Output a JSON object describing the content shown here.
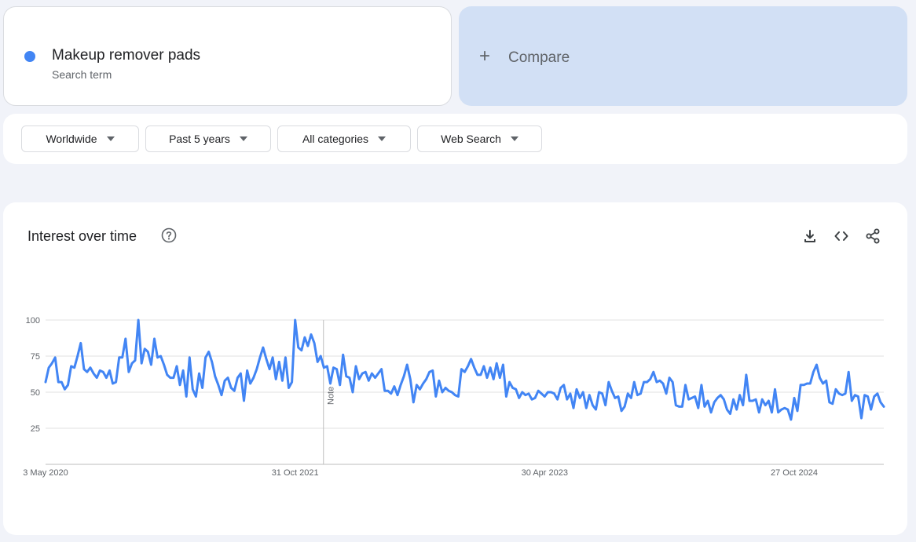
{
  "search_term": {
    "name": "Makeup remover pads",
    "subtitle": "Search term",
    "color": "#4285f4"
  },
  "compare": {
    "label": "Compare",
    "icon": "plus-icon"
  },
  "filters": [
    {
      "label": "Worldwide"
    },
    {
      "label": "Past 5 years"
    },
    {
      "label": "All categories"
    },
    {
      "label": "Web Search"
    }
  ],
  "chart_panel": {
    "title": "Interest over time",
    "icons": [
      "help-icon",
      "download-icon",
      "embed-icon",
      "share-icon"
    ]
  },
  "chart_data": {
    "type": "line",
    "title": "Interest over time",
    "y_ticks": [
      25,
      50,
      75,
      100
    ],
    "ylim": [
      0,
      100
    ],
    "x_ticks": [
      "3 May 2020",
      "31 Oct 2021",
      "30 Apr 2023",
      "27 Oct 2024"
    ],
    "start_date": "2020-05-03",
    "interval_days": 7,
    "note_label": "Note",
    "note_date": "2022-01-01",
    "line_color": "#4285f4",
    "grid": true,
    "series": [
      {
        "values": [
          57,
          67,
          70,
          74,
          57,
          57,
          52,
          55,
          68,
          67,
          75,
          84,
          66,
          64,
          67,
          63,
          60,
          65,
          64,
          60,
          65,
          56,
          57,
          74,
          74,
          87,
          64,
          70,
          72,
          100,
          70,
          80,
          78,
          69,
          87,
          74,
          75,
          69,
          62,
          60,
          60,
          68,
          55,
          65,
          47,
          74,
          52,
          47,
          63,
          53,
          74,
          78,
          71,
          61,
          55,
          48,
          58,
          60,
          53,
          51,
          60,
          63,
          44,
          65,
          56,
          60,
          66,
          74,
          81,
          73,
          66,
          74,
          59,
          71,
          58,
          74,
          53,
          57,
          100,
          81,
          79,
          88,
          82,
          90,
          84,
          71,
          75,
          67,
          68,
          56,
          67,
          66,
          55,
          76,
          61,
          60,
          50,
          68,
          59,
          63,
          64,
          58,
          63,
          60,
          63,
          66,
          51,
          51,
          49,
          54,
          48,
          55,
          61,
          69,
          59,
          43,
          55,
          52,
          56,
          59,
          64,
          65,
          47,
          58,
          50,
          53,
          51,
          50,
          48,
          47,
          66,
          64,
          68,
          73,
          67,
          62,
          62,
          68,
          60,
          67,
          59,
          70,
          60,
          69,
          47,
          57,
          53,
          52,
          46,
          50,
          48,
          49,
          45,
          46,
          51,
          49,
          47,
          50,
          50,
          49,
          45,
          53,
          55,
          45,
          49,
          39,
          52,
          46,
          50,
          39,
          48,
          41,
          38,
          50,
          49,
          41,
          57,
          51,
          46,
          47,
          37,
          40,
          49,
          46,
          57,
          48,
          49,
          57,
          57,
          59,
          64,
          57,
          58,
          56,
          49,
          60,
          57,
          41,
          40,
          40,
          55,
          45,
          46,
          47,
          39,
          55,
          40,
          44,
          36,
          43,
          46,
          48,
          45,
          38,
          35,
          45,
          38,
          48,
          41,
          62,
          44,
          44,
          45,
          36,
          45,
          41,
          44,
          36,
          52,
          36,
          38,
          39,
          38,
          31,
          46,
          37,
          55,
          55,
          56,
          56,
          64,
          69,
          60,
          56,
          58,
          43,
          42,
          52,
          49,
          48,
          49,
          64,
          44,
          48,
          47,
          32,
          48,
          47,
          38,
          47,
          49,
          43,
          40
        ]
      }
    ]
  }
}
